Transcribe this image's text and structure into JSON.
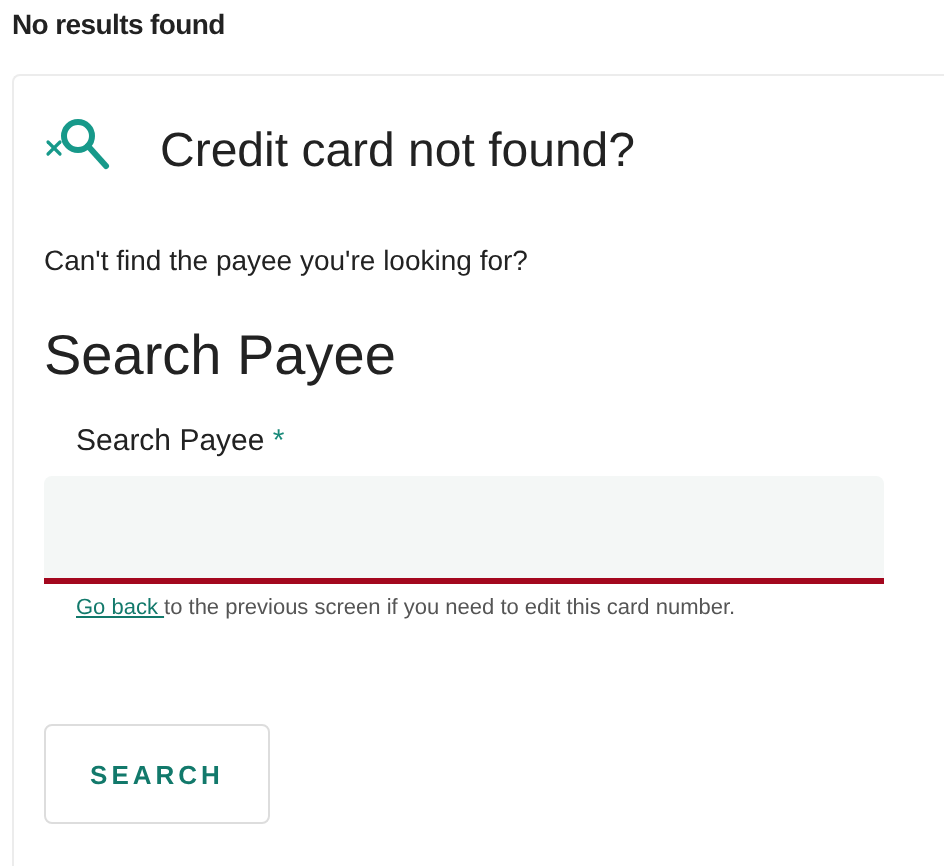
{
  "heading": "No results found",
  "card": {
    "title": "Credit card not found?",
    "prompt": "Can't find the payee you're looking for?",
    "section_title": "Search Payee",
    "field": {
      "label": "Search Payee",
      "required": true,
      "required_mark": "*",
      "error": true
    },
    "helper": {
      "link": "Go back",
      "text": "to the previous screen if you need to edit this card number."
    },
    "button": "SEARCH"
  }
}
